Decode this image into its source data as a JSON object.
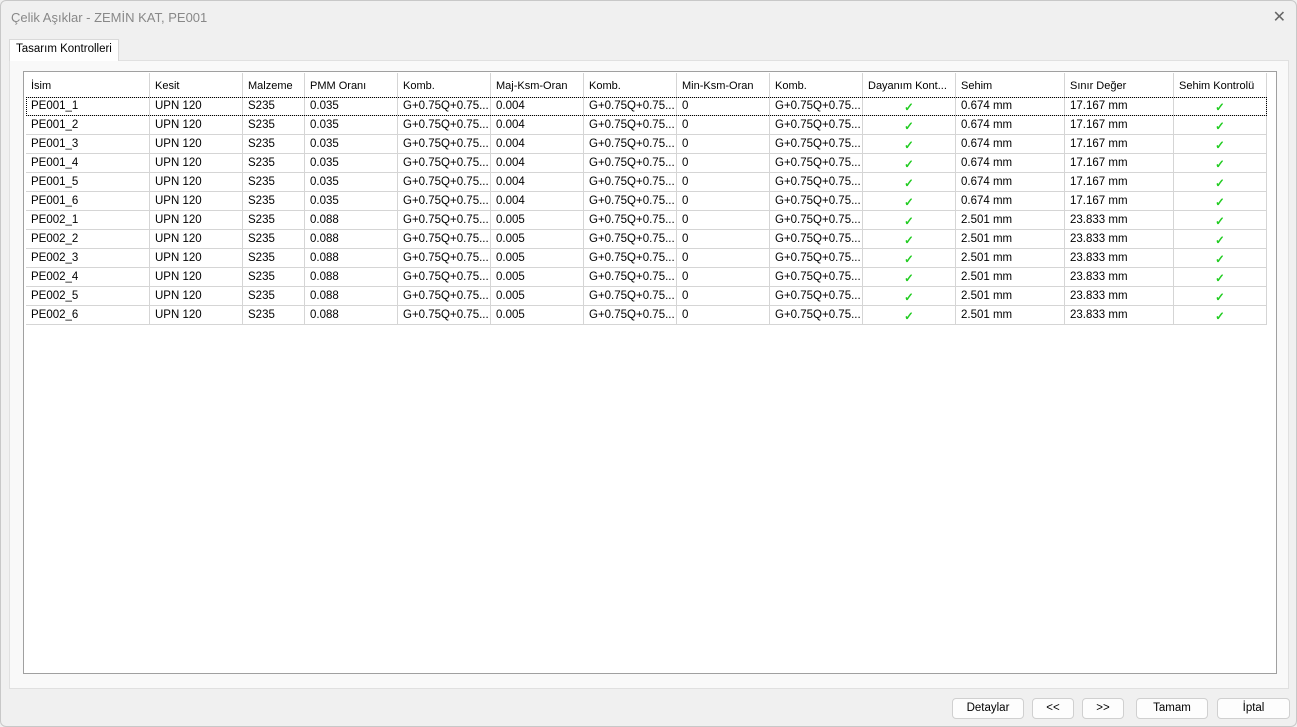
{
  "window": {
    "title": "Çelik Aşıklar - ZEMİN KAT, PE001",
    "close": "✕"
  },
  "tab": "Tasarım Kontrolleri",
  "columns": [
    "İsim",
    "Kesit",
    "Malzeme",
    "PMM Oranı",
    "Komb.",
    "Maj-Ksm-Oran",
    "Komb.",
    "Min-Ksm-Oran",
    "Komb.",
    "Dayanım Kont...",
    "Sehim",
    "Sınır Değer",
    "Sehim Kontrolü"
  ],
  "check_color": "#22cc22",
  "rows": [
    [
      "PE001_1",
      "UPN 120",
      "S235",
      "0.035",
      "G+0.75Q+0.75...",
      "0.004",
      "G+0.75Q+0.75...",
      "0",
      "G+0.75Q+0.75...",
      "✓",
      "0.674 mm",
      "17.167 mm",
      "✓"
    ],
    [
      "PE001_2",
      "UPN 120",
      "S235",
      "0.035",
      "G+0.75Q+0.75...",
      "0.004",
      "G+0.75Q+0.75...",
      "0",
      "G+0.75Q+0.75...",
      "✓",
      "0.674 mm",
      "17.167 mm",
      "✓"
    ],
    [
      "PE001_3",
      "UPN 120",
      "S235",
      "0.035",
      "G+0.75Q+0.75...",
      "0.004",
      "G+0.75Q+0.75...",
      "0",
      "G+0.75Q+0.75...",
      "✓",
      "0.674 mm",
      "17.167 mm",
      "✓"
    ],
    [
      "PE001_4",
      "UPN 120",
      "S235",
      "0.035",
      "G+0.75Q+0.75...",
      "0.004",
      "G+0.75Q+0.75...",
      "0",
      "G+0.75Q+0.75...",
      "✓",
      "0.674 mm",
      "17.167 mm",
      "✓"
    ],
    [
      "PE001_5",
      "UPN 120",
      "S235",
      "0.035",
      "G+0.75Q+0.75...",
      "0.004",
      "G+0.75Q+0.75...",
      "0",
      "G+0.75Q+0.75...",
      "✓",
      "0.674 mm",
      "17.167 mm",
      "✓"
    ],
    [
      "PE001_6",
      "UPN 120",
      "S235",
      "0.035",
      "G+0.75Q+0.75...",
      "0.004",
      "G+0.75Q+0.75...",
      "0",
      "G+0.75Q+0.75...",
      "✓",
      "0.674 mm",
      "17.167 mm",
      "✓"
    ],
    [
      "PE002_1",
      "UPN 120",
      "S235",
      "0.088",
      "G+0.75Q+0.75...",
      "0.005",
      "G+0.75Q+0.75...",
      "0",
      "G+0.75Q+0.75...",
      "✓",
      "2.501 mm",
      "23.833 mm",
      "✓"
    ],
    [
      "PE002_2",
      "UPN 120",
      "S235",
      "0.088",
      "G+0.75Q+0.75...",
      "0.005",
      "G+0.75Q+0.75...",
      "0",
      "G+0.75Q+0.75...",
      "✓",
      "2.501 mm",
      "23.833 mm",
      "✓"
    ],
    [
      "PE002_3",
      "UPN 120",
      "S235",
      "0.088",
      "G+0.75Q+0.75...",
      "0.005",
      "G+0.75Q+0.75...",
      "0",
      "G+0.75Q+0.75...",
      "✓",
      "2.501 mm",
      "23.833 mm",
      "✓"
    ],
    [
      "PE002_4",
      "UPN 120",
      "S235",
      "0.088",
      "G+0.75Q+0.75...",
      "0.005",
      "G+0.75Q+0.75...",
      "0",
      "G+0.75Q+0.75...",
      "✓",
      "2.501 mm",
      "23.833 mm",
      "✓"
    ],
    [
      "PE002_5",
      "UPN 120",
      "S235",
      "0.088",
      "G+0.75Q+0.75...",
      "0.005",
      "G+0.75Q+0.75...",
      "0",
      "G+0.75Q+0.75...",
      "✓",
      "2.501 mm",
      "23.833 mm",
      "✓"
    ],
    [
      "PE002_6",
      "UPN 120",
      "S235",
      "0.088",
      "G+0.75Q+0.75...",
      "0.005",
      "G+0.75Q+0.75...",
      "0",
      "G+0.75Q+0.75...",
      "✓",
      "2.501 mm",
      "23.833 mm",
      "✓"
    ]
  ],
  "buttons": {
    "details": "Detaylar",
    "prev": "<<",
    "next": ">>",
    "ok": "Tamam",
    "cancel": "İptal"
  }
}
